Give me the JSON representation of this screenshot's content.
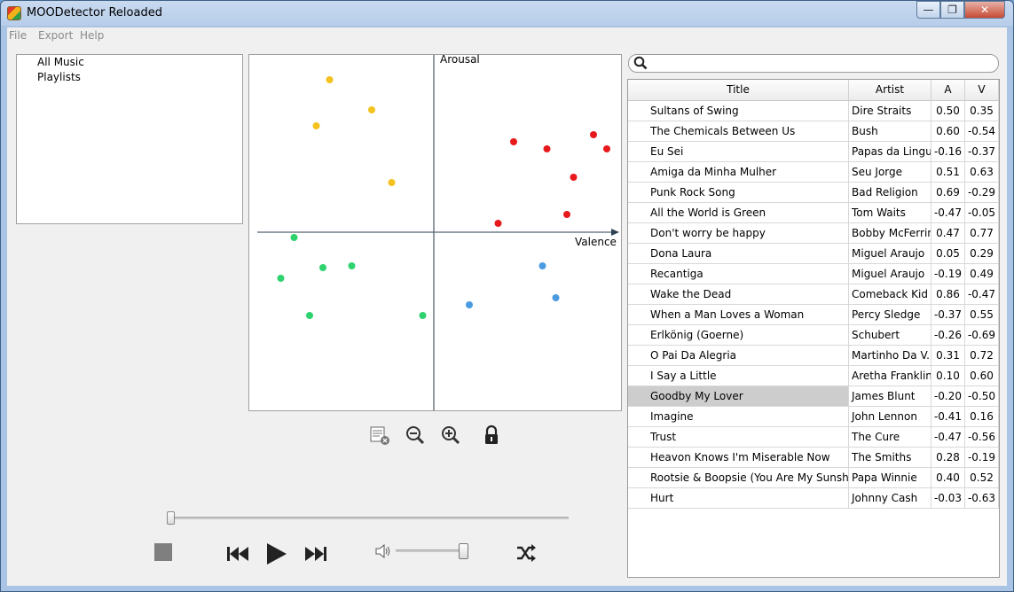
{
  "window": {
    "title": "MOODetector Reloaded",
    "min_glyph": "—",
    "max_glyph": "❐",
    "close_glyph": "✕"
  },
  "menu": {
    "file": "File",
    "export": "Export",
    "help": "Help"
  },
  "library": {
    "items": [
      "All Music",
      "Playlists"
    ]
  },
  "mood_plot": {
    "y_axis_label": "Arousal",
    "x_axis_label": "Valence",
    "colors": {
      "quadrant1": "#e8191c",
      "quadrant2": "#f4c21e",
      "quadrant3": "#2ed36e",
      "quadrant4": "#4a9be0"
    },
    "points": {
      "quadrant2": [
        [
          -0.47,
          0.86
        ],
        [
          -0.28,
          0.69
        ],
        [
          -0.53,
          0.6
        ],
        [
          -0.19,
          0.28
        ]
      ],
      "quadrant1": [
        [
          0.36,
          0.51
        ],
        [
          0.51,
          0.47
        ],
        [
          0.72,
          0.55
        ],
        [
          0.78,
          0.47
        ],
        [
          0.63,
          0.31
        ],
        [
          0.6,
          0.1
        ],
        [
          0.29,
          0.05
        ]
      ],
      "quadrant3": [
        [
          -0.63,
          -0.03
        ],
        [
          -0.37,
          -0.19
        ],
        [
          -0.5,
          -0.2
        ],
        [
          -0.69,
          -0.26
        ],
        [
          -0.56,
          -0.47
        ],
        [
          -0.05,
          -0.47
        ]
      ],
      "quadrant4": [
        [
          0.49,
          -0.19
        ],
        [
          0.55,
          -0.37
        ],
        [
          0.16,
          -0.41
        ]
      ]
    }
  },
  "plot_tools": {
    "clear_label": "clear",
    "zoom_out_label": "zoom out",
    "zoom_in_label": "zoom in",
    "lock_label": "lock"
  },
  "player": {
    "stop": "stop",
    "previous": "previous",
    "play": "play",
    "next": "next",
    "shuffle": "shuffle"
  },
  "search": {
    "placeholder": "",
    "value": ""
  },
  "songs": {
    "columns": {
      "title": "Title",
      "artist": "Artist",
      "a": "A",
      "v": "V"
    },
    "rows": [
      {
        "title": "Sultans of Swing",
        "artist": "Dire Straits",
        "a": "0.50",
        "v": "0.35"
      },
      {
        "title": "The Chemicals Between Us",
        "artist": "Bush",
        "a": "0.60",
        "v": "-0.54"
      },
      {
        "title": "Eu Sei",
        "artist": "Papas da Lingua",
        "a": "-0.16",
        "v": "-0.37"
      },
      {
        "title": "Amiga da Minha Mulher",
        "artist": "Seu Jorge",
        "a": "0.51",
        "v": "0.63"
      },
      {
        "title": "Punk Rock Song",
        "artist": "Bad Religion",
        "a": "0.69",
        "v": "-0.29"
      },
      {
        "title": "All the World is Green",
        "artist": "Tom Waits",
        "a": "-0.47",
        "v": "-0.05"
      },
      {
        "title": "Don't worry be happy",
        "artist": "Bobby McFerrin",
        "a": "0.47",
        "v": "0.77"
      },
      {
        "title": "Dona Laura",
        "artist": "Miguel Araujo",
        "a": "0.05",
        "v": "0.29"
      },
      {
        "title": "Recantiga",
        "artist": "Miguel Araujo",
        "a": "-0.19",
        "v": "0.49"
      },
      {
        "title": "Wake the Dead",
        "artist": "Comeback Kid",
        "a": "0.86",
        "v": "-0.47"
      },
      {
        "title": "When a Man Loves a Woman",
        "artist": "Percy Sledge",
        "a": "-0.37",
        "v": "0.55"
      },
      {
        "title": "Erlkönig (Goerne)",
        "artist": "Schubert",
        "a": "-0.26",
        "v": "-0.69"
      },
      {
        "title": "O Pai Da Alegria",
        "artist": "Martinho Da V...",
        "a": "0.31",
        "v": "0.72"
      },
      {
        "title": "I Say a Little",
        "artist": "Aretha Franklin",
        "a": "0.10",
        "v": "0.60"
      },
      {
        "title": "Goodby My Lover",
        "artist": "James Blunt",
        "a": "-0.20",
        "v": "-0.50",
        "selected": true
      },
      {
        "title": "Imagine",
        "artist": "John Lennon",
        "a": "-0.41",
        "v": "0.16"
      },
      {
        "title": "Trust",
        "artist": "The Cure",
        "a": "-0.47",
        "v": "-0.56"
      },
      {
        "title": "Heavon Knows I'm Miserable Now",
        "artist": "The Smiths",
        "a": "0.28",
        "v": "-0.19"
      },
      {
        "title": "Rootsie & Boopsie (You Are My Sunshine)",
        "artist": "Papa Winnie",
        "a": "0.40",
        "v": "0.52"
      },
      {
        "title": "Hurt",
        "artist": "Johnny Cash",
        "a": "-0.03",
        "v": "-0.63"
      }
    ]
  }
}
